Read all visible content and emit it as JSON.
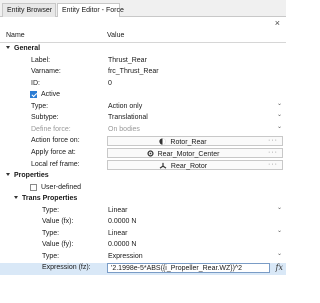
{
  "tabs": [
    {
      "label": "Entity Browser",
      "active": false
    },
    {
      "label": "Entity Editor - Force",
      "active": true
    }
  ],
  "close_label": "×",
  "columns": {
    "name": "Name",
    "value": "Value"
  },
  "rows": [
    {
      "label": "General",
      "kind": "section"
    },
    {
      "label": "Label:",
      "value": "Thrust_Rear"
    },
    {
      "label": "Varname:",
      "value": "frc_Thrust_Rear"
    },
    {
      "label": "ID:",
      "value": "0"
    },
    {
      "label": "Active",
      "kind": "checkbox",
      "checked": true
    },
    {
      "label": "Type:",
      "value": "Action only",
      "dropdown": true
    },
    {
      "label": "Subtype:",
      "value": "Translational",
      "dropdown": true
    },
    {
      "label": "Define force:",
      "value": "On bodies",
      "disabled": true,
      "dropdown": true
    },
    {
      "label": "Action force on:",
      "value": "Rotor_Rear",
      "picker": true,
      "icon": "body-icon"
    },
    {
      "label": "Apply force at:",
      "value": "Rear_Motor_Center",
      "picker": true,
      "icon": "point-icon"
    },
    {
      "label": "Local ref frame:",
      "value": "Rear_Rotor",
      "picker": true,
      "icon": "frame-icon"
    },
    {
      "label": "Properties",
      "kind": "section"
    },
    {
      "label": "User-defined",
      "kind": "checkbox",
      "checked": false
    },
    {
      "label": "Trans Properties",
      "kind": "subsection"
    },
    {
      "label": "Type:",
      "value": "Linear",
      "dropdown": true
    },
    {
      "label": "Value (fx):",
      "value": "0.0000 N"
    },
    {
      "label": "Type:",
      "value": "Linear",
      "dropdown": true
    },
    {
      "label": "Value (fy):",
      "value": "0.0000 N"
    },
    {
      "label": "Type:",
      "value": "Expression",
      "dropdown": true
    },
    {
      "label": "Expression (fz):",
      "value": "'2.1998e-5*ABS({i_Propeller_Rear.WZ})^2",
      "expression": true
    }
  ],
  "fx_label": "fx",
  "accent_color": "#2b7cd3",
  "selection_color": "#d9e8f7"
}
